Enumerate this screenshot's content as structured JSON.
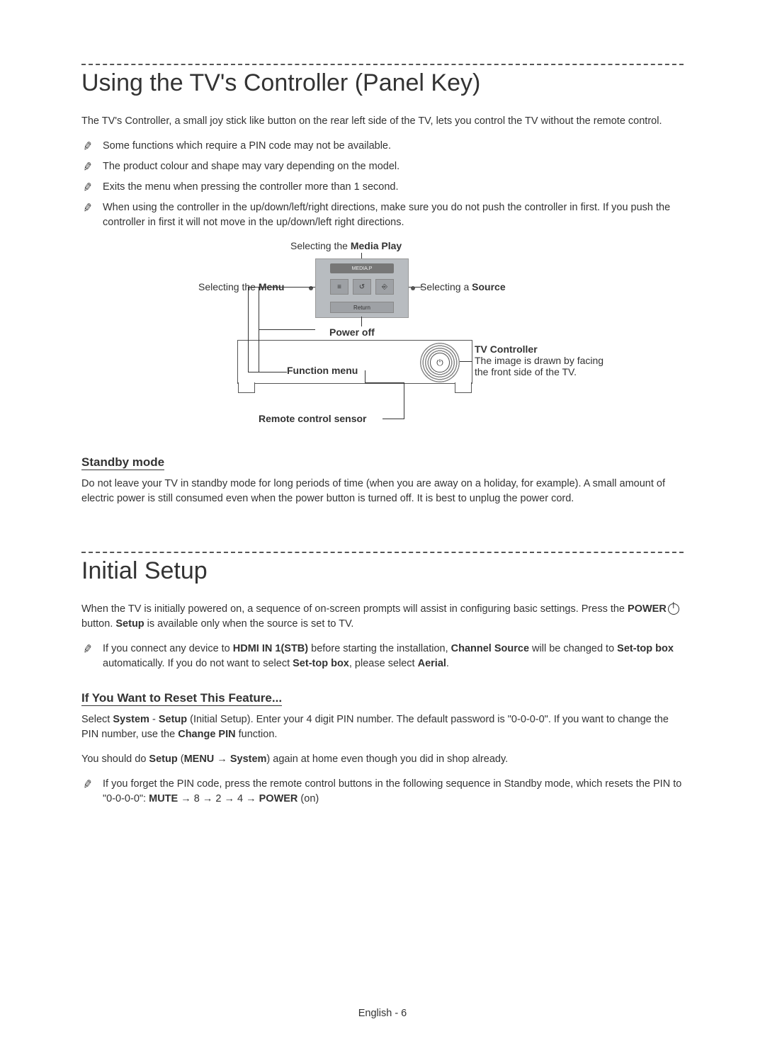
{
  "section1": {
    "title": "Using the TV's Controller (Panel Key)",
    "intro": "The TV's Controller, a small joy stick like button on the rear left side of the TV, lets you control the TV without the remote control.",
    "notes": [
      "Some functions which require a PIN code may not be available.",
      "The product colour and shape may vary depending on the model.",
      "Exits the menu when pressing the controller more than 1 second.",
      "When using the controller in the up/down/left/right directions, make sure you do not push the controller in first. If you push the controller in first it will not move in the up/down/left right directions."
    ],
    "diagram": {
      "media_play_pre": "Selecting the ",
      "media_play_b": "Media Play",
      "menu_pre": "Selecting the ",
      "menu_b": "Menu",
      "source_pre": "Selecting a ",
      "source_b": "Source",
      "power_off": "Power off",
      "function_menu": "Function menu",
      "tv_controller": "TV Controller",
      "tv_controller_desc": "The image is drawn by facing the front side of the TV.",
      "remote_sensor": "Remote control sensor",
      "panel_return": "Return",
      "panel_media": "MEDIA.P"
    },
    "standby_heading": "Standby mode",
    "standby_body": "Do not leave your TV in standby mode for long periods of time (when you are away on a holiday, for example). A small amount of electric power is still consumed even when the power button is turned off. It is best to unplug the power cord."
  },
  "section2": {
    "title": "Initial Setup",
    "intro_pre": "When the TV is initially powered on, a sequence of on-screen prompts will assist in configuring basic settings. Press the ",
    "intro_power": "POWER",
    "intro_mid": " button. ",
    "intro_setup": "Setup",
    "intro_post": " is available only when the source is set to TV.",
    "note1_pre": "If you connect any device to ",
    "note1_hdmi": "HDMI IN 1(STB)",
    "note1_mid1": " before starting the installation, ",
    "note1_channel": "Channel Source",
    "note1_mid2": " will be changed to ",
    "note1_stb": "Set-top box",
    "note1_mid3": " automatically. If you do not want to select ",
    "note1_stb2": "Set-top box",
    "note1_mid4": ", please select ",
    "note1_aerial": "Aerial",
    "note1_end": ".",
    "reset_heading": "If You Want to Reset This Feature...",
    "reset1_pre": "Select ",
    "reset1_system": "System",
    "reset1_dash": " - ",
    "reset1_setup": "Setup",
    "reset1_mid": " (Initial Setup). Enter your 4 digit PIN number. The default password is \"0-0-0-0\". If you want to change the PIN number, use the ",
    "reset1_change": "Change PIN",
    "reset1_end": " function.",
    "reset2_pre": "You should do ",
    "reset2_setup": "Setup",
    "reset2_paren_open": " (",
    "reset2_menu": "MENU",
    "reset2_arrow": " → ",
    "reset2_system": "System",
    "reset2_paren_close": ")",
    "reset2_end": " again at home even though you did in shop already.",
    "note2_pre": "If you forget the PIN code, press the remote control buttons in the following sequence in Standby mode, which resets the PIN to \"0-0-0-0\": ",
    "note2_mute": "MUTE",
    "note2_seq_mid": " → 8 → 2 → 4 → ",
    "note2_power": "POWER",
    "note2_on": " (on)"
  },
  "footer": {
    "lang": "English - 6"
  }
}
